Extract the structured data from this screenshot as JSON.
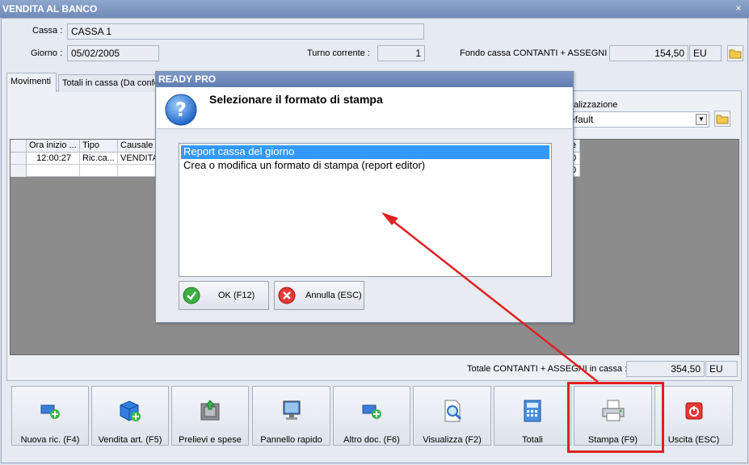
{
  "window": {
    "title": "VENDITA AL BANCO",
    "close": "×"
  },
  "header": {
    "cassa_label": "Cassa :",
    "cassa_value": "CASSA 1",
    "giorno_label": "Giorno :",
    "giorno_value": "05/02/2005",
    "turno_label": "Turno corrente :",
    "turno_value": "1",
    "fondo_label": "Fondo cassa CONTANTI + ASSEGNI :",
    "fondo_value": "154,50",
    "fondo_currency": "EU"
  },
  "tabs": [
    {
      "label": "Movimenti"
    },
    {
      "label": "Totali in cassa (Da confe"
    }
  ],
  "visualizzazione": {
    "label": "alizzazione",
    "value": "efault"
  },
  "table": {
    "columns": [
      "Ora inizio ...",
      "Tipo",
      "Causale"
    ],
    "rows": [
      {
        "ora": "12:00:27",
        "tipo": "Ric.ca...",
        "causale": "VENDITA"
      }
    ],
    "right_header": "e",
    "right_cells": [
      "0",
      "0"
    ]
  },
  "totale": {
    "label": "Totale CONTANTI + ASSEGNI in cassa :",
    "value": "354,50",
    "currency": "EU"
  },
  "buttons": [
    {
      "label": "Nuova ric. (F4)",
      "icon": "new-receipt-icon"
    },
    {
      "label": "Vendita art. (F5)",
      "icon": "sell-article-icon"
    },
    {
      "label": "Prelievi e spese",
      "icon": "safe-withdrawal-icon"
    },
    {
      "label": "Pannello rapido",
      "icon": "monitor-icon"
    },
    {
      "label": "Altro doc. (F6)",
      "icon": "other-document-icon"
    },
    {
      "label": "Visualizza (F2)",
      "icon": "preview-magnifier-icon"
    },
    {
      "label": "Totali",
      "icon": "calculator-icon"
    },
    {
      "label": "Stampa (F9)",
      "icon": "printer-icon"
    },
    {
      "label": "Uscita (ESC)",
      "icon": "power-exit-icon"
    }
  ],
  "dialog": {
    "title": "READY PRO",
    "message": "Selezionare il formato di stampa",
    "options": [
      "Report cassa del giorno",
      "Crea o modifica un formato di stampa (report editor)"
    ],
    "ok_label": "OK (F12)",
    "cancel_label": "Annulla (ESC)"
  },
  "colors": {
    "highlight_red": "#e02020",
    "selection": "#3399ff",
    "titlebar": "#7390c0"
  }
}
